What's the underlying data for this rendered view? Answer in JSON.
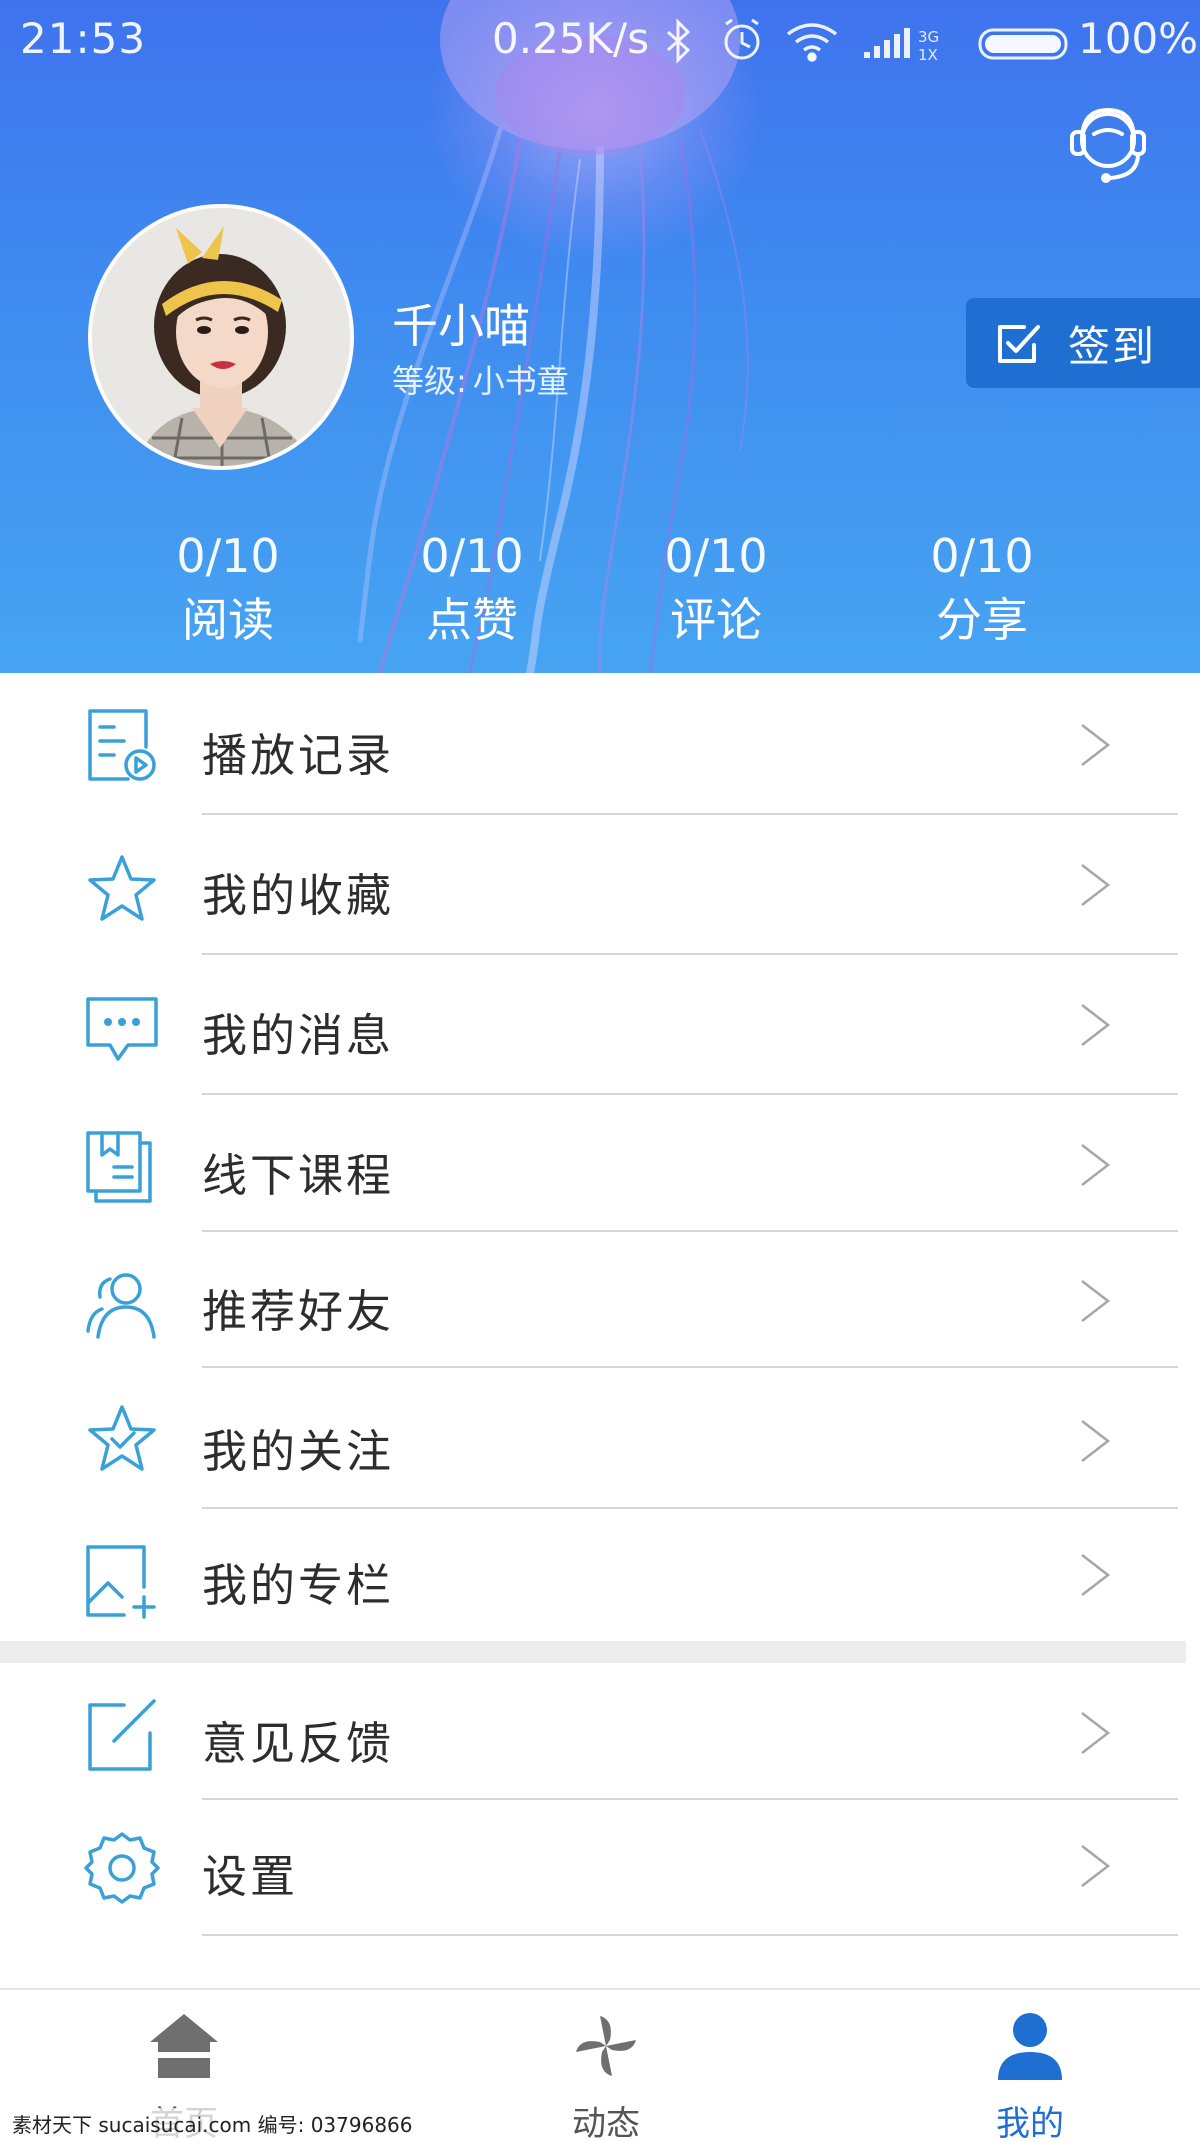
{
  "status_bar": {
    "time": "21:53",
    "network_speed": "0.25K/s",
    "network_type_top": "3G",
    "network_type_bottom": "1X",
    "battery": "100%"
  },
  "profile": {
    "name": "千小喵",
    "level_label": "等级:",
    "level_value": "小书童",
    "signin_label": "签到"
  },
  "stats": [
    {
      "value": "0/10",
      "label": "阅读"
    },
    {
      "value": "0/10",
      "label": "点赞"
    },
    {
      "value": "0/10",
      "label": "评论"
    },
    {
      "value": "0/10",
      "label": "分享"
    }
  ],
  "menu": {
    "group1": [
      {
        "label": "播放记录",
        "icon": "play-history-icon"
      },
      {
        "label": "我的收藏",
        "icon": "star-icon"
      },
      {
        "label": "我的消息",
        "icon": "message-icon"
      },
      {
        "label": "线下课程",
        "icon": "course-book-icon"
      },
      {
        "label": "推荐好友",
        "icon": "users-icon"
      },
      {
        "label": "我的关注",
        "icon": "star-check-icon"
      },
      {
        "label": "我的专栏",
        "icon": "column-add-icon"
      }
    ],
    "group2": [
      {
        "label": "意见反馈",
        "icon": "feedback-edit-icon"
      },
      {
        "label": "设置",
        "icon": "gear-icon"
      }
    ]
  },
  "bottom_nav": [
    {
      "label": "首页",
      "icon": "home-icon",
      "active": false
    },
    {
      "label": "动态",
      "icon": "pinwheel-icon",
      "active": false
    },
    {
      "label": "我的",
      "icon": "person-icon",
      "active": true
    }
  ],
  "watermark": "素材天下 sucaisucai.com  编号: 03796866",
  "colors": {
    "header_top": "#3f73ee",
    "header_bottom": "#47a4f2",
    "accent_blue": "#1f6fd2",
    "icon_blue": "#3aa0d8",
    "divider": "#d6d6d6"
  }
}
